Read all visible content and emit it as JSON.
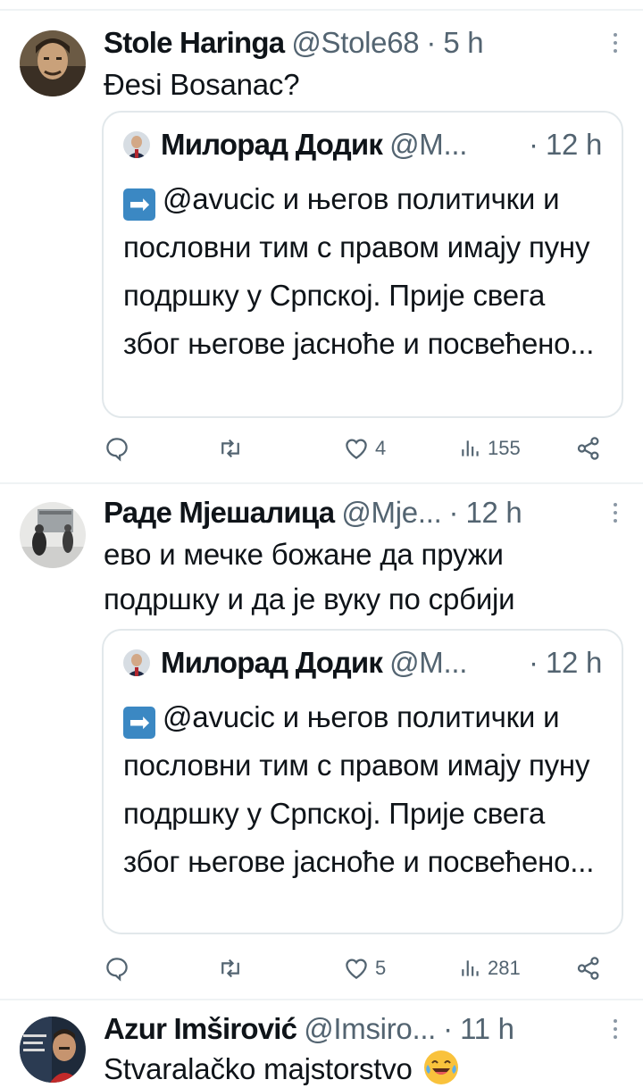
{
  "tweets": [
    {
      "name": "Stole Haringa",
      "handle": "@Stole68",
      "time": "5 h",
      "text": "Đesi Bosanac?",
      "quote": {
        "name": "Милорад Додик",
        "handle": "@M...",
        "time": "12 h",
        "text": "@avucic и његов политички и пословни тим с правом имају пуну подршку у Српској. Прије свега због његове јасноће и посвећено..."
      },
      "stats": {
        "likes": "4",
        "views": "155"
      }
    },
    {
      "name": "Раде Мјешалица",
      "handle": "@Мје...",
      "time": "12 h",
      "text": "ево и мечке божане да пружи подршку и да је вуку по србији",
      "quote": {
        "name": "Милорад Додик",
        "handle": "@M...",
        "time": "12 h",
        "text": "@avucic и његов политички и пословни тим с правом имају пуну подршку у Српској. Прије свега због његове јасноће и посвећено..."
      },
      "stats": {
        "likes": "5",
        "views": "281"
      }
    },
    {
      "name": "Azur Imširović",
      "handle": "@Imsiro...",
      "time": "11 h",
      "text": "Stvaralačko majstorstvo"
    }
  ],
  "separator": "·",
  "icons": {
    "reply": "reply-icon",
    "retweet": "retweet-icon",
    "like": "heart-icon",
    "views": "views-icon",
    "share": "share-icon",
    "more": "more-icon",
    "quote_emoji": "right-arrow-emoji-icon",
    "laugh_emoji": "tears-of-joy-emoji-icon"
  },
  "colors": {
    "text": "#0f1419",
    "secondary": "#536471",
    "border": "#eff3f4",
    "emoji_arrow": "#3b88c3"
  }
}
